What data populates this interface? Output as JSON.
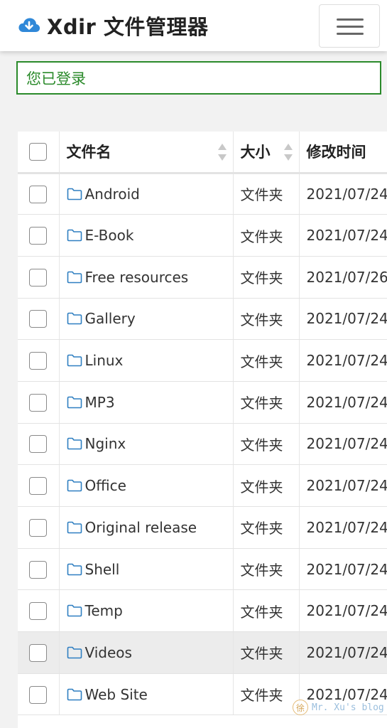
{
  "header": {
    "title": "Xdir 文件管理器",
    "logo_icon": "cloud-download-icon",
    "menu_icon": "hamburger-menu-icon"
  },
  "alert": {
    "text": "您已登录",
    "color": "#2a8a2a"
  },
  "table": {
    "columns": [
      "文件名",
      "大小",
      "修改时间"
    ],
    "rows": [
      {
        "name": "Android",
        "size": "文件夹",
        "modified": "2021/07/24"
      },
      {
        "name": "E-Book",
        "size": "文件夹",
        "modified": "2021/07/24"
      },
      {
        "name": "Free resources",
        "size": "文件夹",
        "modified": "2021/07/26"
      },
      {
        "name": "Gallery",
        "size": "文件夹",
        "modified": "2021/07/24"
      },
      {
        "name": "Linux",
        "size": "文件夹",
        "modified": "2021/07/24"
      },
      {
        "name": "MP3",
        "size": "文件夹",
        "modified": "2021/07/24"
      },
      {
        "name": "Nginx",
        "size": "文件夹",
        "modified": "2021/07/24"
      },
      {
        "name": "Office",
        "size": "文件夹",
        "modified": "2021/07/24"
      },
      {
        "name": "Original release",
        "size": "文件夹",
        "modified": "2021/07/24"
      },
      {
        "name": "Shell",
        "size": "文件夹",
        "modified": "2021/07/24"
      },
      {
        "name": "Temp",
        "size": "文件夹",
        "modified": "2021/07/24"
      },
      {
        "name": "Videos",
        "size": "文件夹",
        "modified": "2021/07/24"
      },
      {
        "name": "Web Site",
        "size": "文件夹",
        "modified": "2021/07/24"
      }
    ],
    "highlighted_row": "Videos",
    "folder_icon": "folder-icon",
    "folder_color": "#2f7fc1"
  },
  "watermark": {
    "badge": "徐",
    "text": "Mr. Xu's blog"
  },
  "colors": {
    "brand_blue": "#2f88d8",
    "success_green": "#2a8a2a"
  }
}
